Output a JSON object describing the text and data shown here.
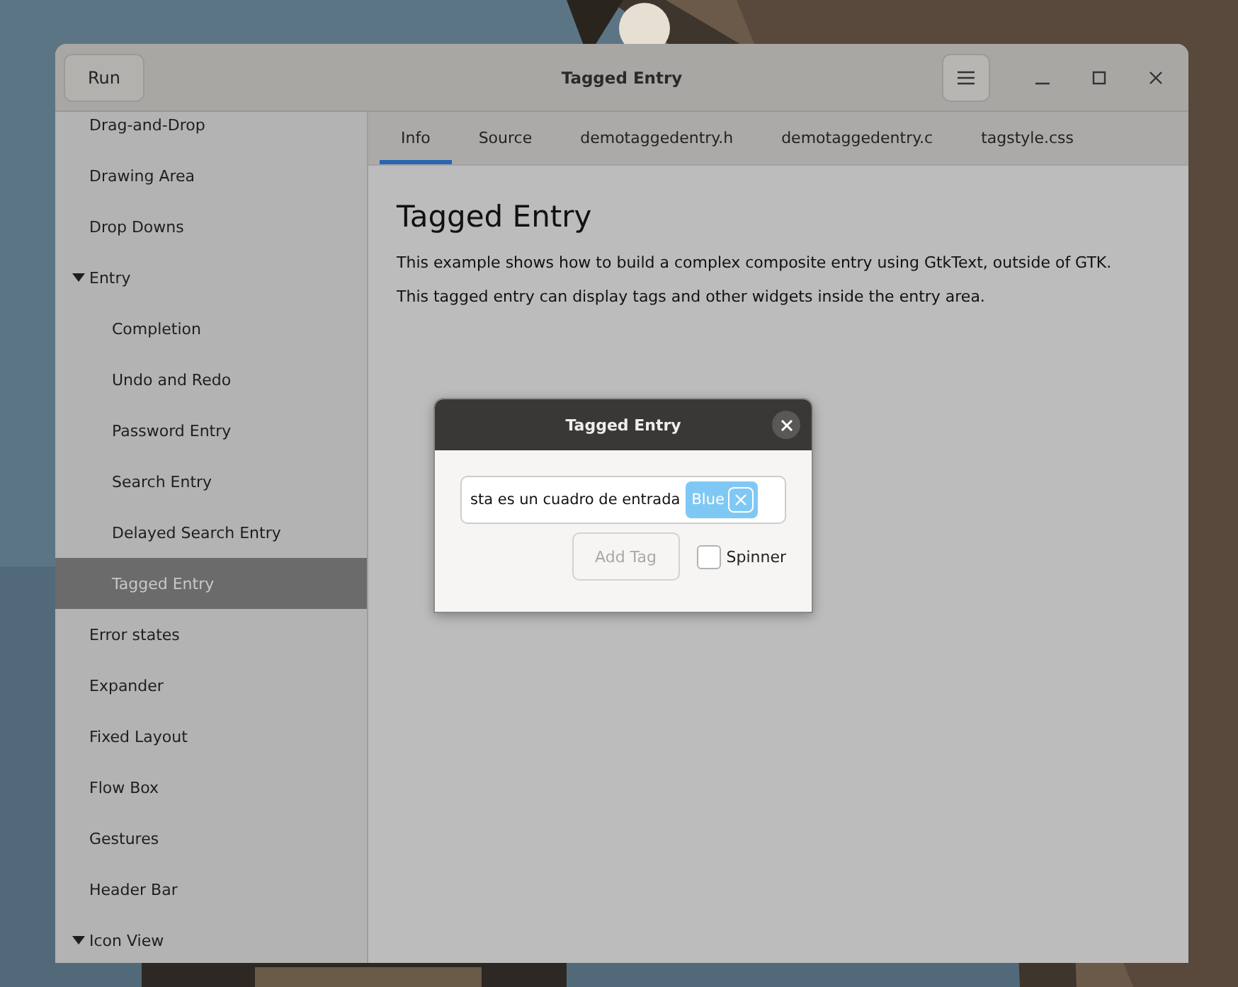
{
  "window": {
    "title": "Tagged Entry",
    "run_button": "Run"
  },
  "sidebar": {
    "items": [
      {
        "label": "Drag-and-Drop",
        "selected": false
      },
      {
        "label": "Drawing Area",
        "selected": false
      },
      {
        "label": "Drop Downs",
        "selected": false
      },
      {
        "label": "Entry",
        "selected": false,
        "expanded": true,
        "children": [
          {
            "label": "Completion",
            "selected": false
          },
          {
            "label": "Undo and Redo",
            "selected": false
          },
          {
            "label": "Password Entry",
            "selected": false
          },
          {
            "label": "Search Entry",
            "selected": false
          },
          {
            "label": "Delayed Search Entry",
            "selected": false
          },
          {
            "label": "Tagged Entry",
            "selected": true
          }
        ]
      },
      {
        "label": "Error states",
        "selected": false
      },
      {
        "label": "Expander",
        "selected": false
      },
      {
        "label": "Fixed Layout",
        "selected": false
      },
      {
        "label": "Flow Box",
        "selected": false
      },
      {
        "label": "Gestures",
        "selected": false
      },
      {
        "label": "Header Bar",
        "selected": false
      },
      {
        "label": "Icon View",
        "selected": false,
        "expanded": true
      }
    ]
  },
  "tabs": [
    {
      "label": "Info",
      "selected": true
    },
    {
      "label": "Source",
      "selected": false
    },
    {
      "label": "demotaggedentry.h",
      "selected": false
    },
    {
      "label": "demotaggedentry.c",
      "selected": false
    },
    {
      "label": "tagstyle.css",
      "selected": false
    }
  ],
  "info": {
    "title": "Tagged Entry",
    "paragraphs": [
      "This example shows how to build a complex composite entry using GtkText, outside of GTK.",
      "This tagged entry can display tags and other widgets inside the entry area."
    ]
  },
  "dialog": {
    "title": "Tagged Entry",
    "entry_value": "sta es un cuadro de entrada",
    "tags": [
      {
        "label": "Blue"
      }
    ],
    "add_button": {
      "label": "Add Tag",
      "disabled": true
    },
    "spinner": {
      "label": "Spinner",
      "checked": false
    }
  }
}
